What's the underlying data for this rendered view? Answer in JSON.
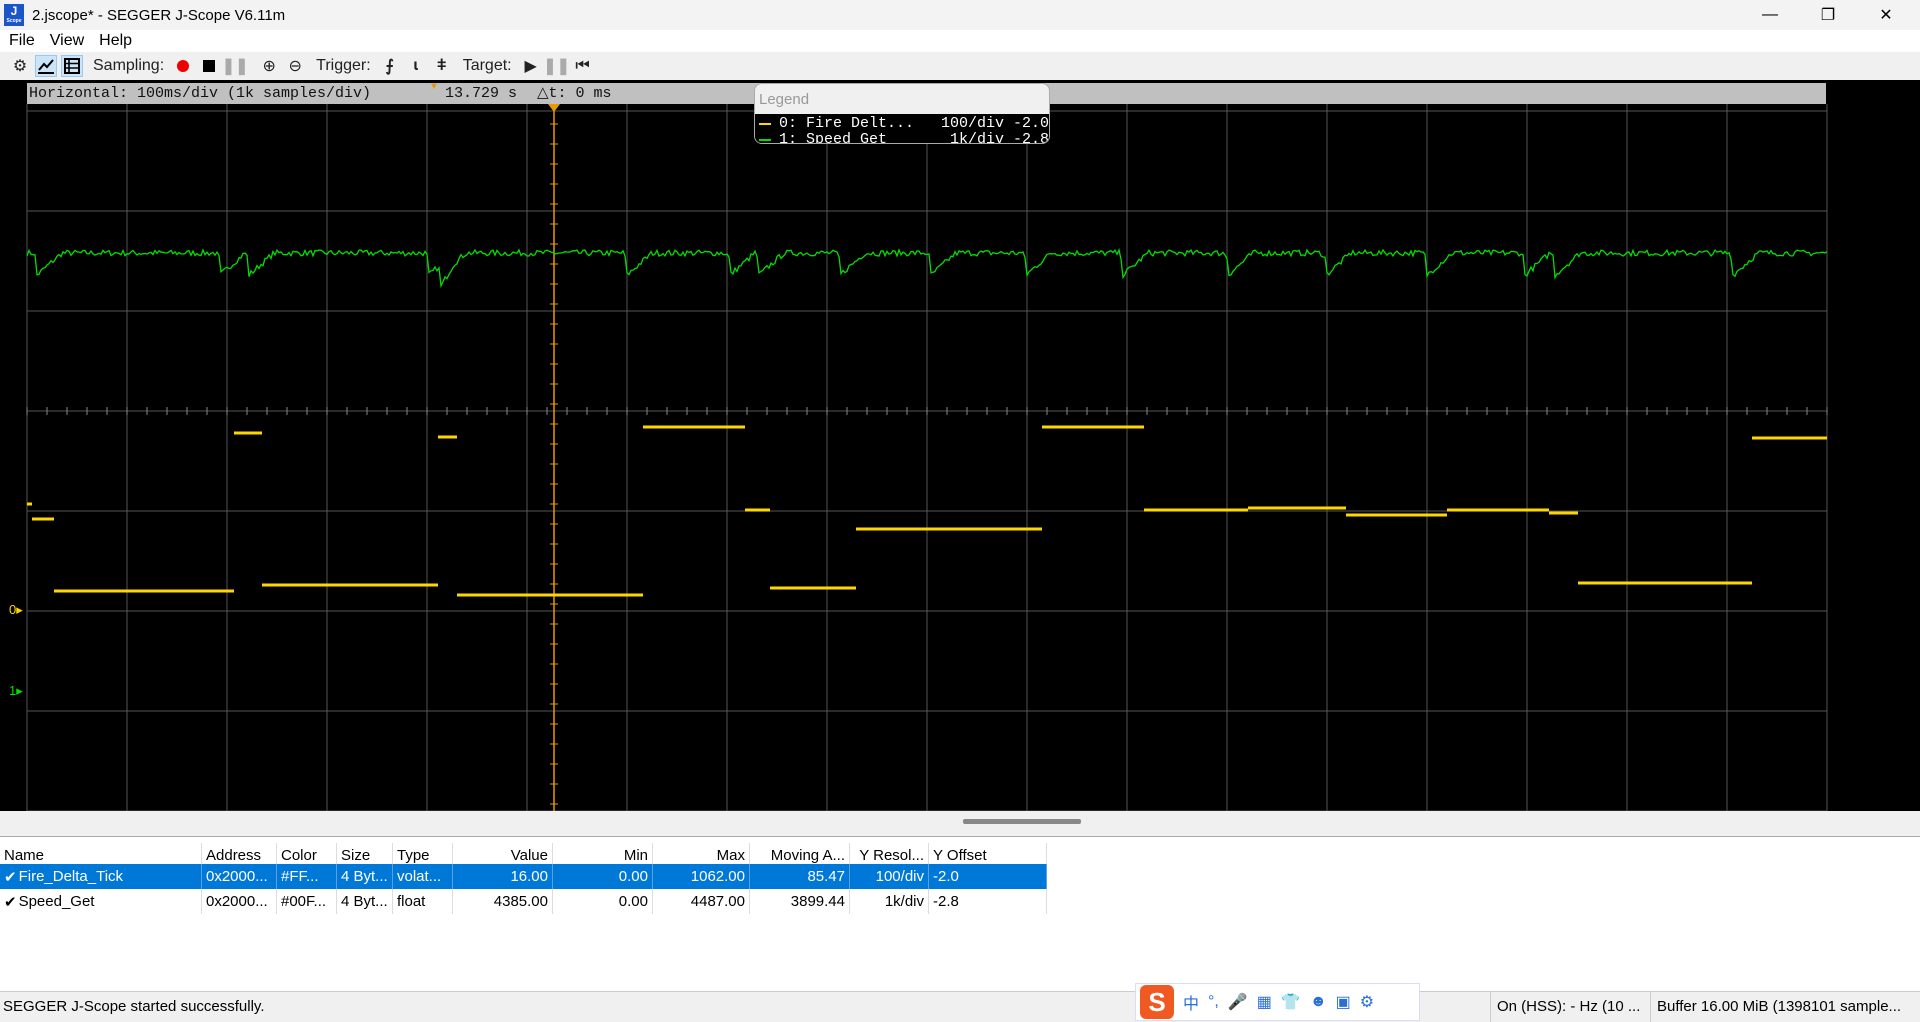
{
  "window": {
    "title": "2.jscope* - SEGGER J-Scope V6.11m",
    "app_icon": "J",
    "app_icon_sub": "Scope",
    "minimize": "—",
    "restore": "❐",
    "close": "✕"
  },
  "menu": [
    "File",
    "View",
    "Help"
  ],
  "toolbar": {
    "sampling_label": "Sampling:",
    "trigger_label": "Trigger:",
    "target_label": "Target:"
  },
  "scope": {
    "horizontal": "Horizontal: 100ms/div (1k samples/div)",
    "cursor_time": "13.729 s",
    "delta_t": "△t: 0 ms",
    "colors": {
      "ch0": "#ffd700",
      "ch1": "#00e000",
      "cursor": "#e89a00",
      "grid": "#555555"
    }
  },
  "legend": {
    "title": "Legend",
    "items": [
      {
        "text": "0: Fire Delt...   100/div -2.0",
        "color": "#ffd700"
      },
      {
        "text": "1: Speed Get       1k/div -2.8",
        "color": "#00e000"
      }
    ]
  },
  "markers": [
    {
      "label": "0",
      "color": "#ffd700"
    },
    {
      "label": "1",
      "color": "#00e000"
    }
  ],
  "chart_data": {
    "type": "line",
    "x_unit": "ms",
    "x_per_div": 100,
    "x_range": [
      0,
      1800
    ],
    "series": [
      {
        "name": "Fire_Delta_Tick",
        "units_per_div": 100,
        "offset_div": -2.0,
        "color": "#ffd700",
        "steps": [
          [
            0,
            5,
            107
          ],
          [
            5,
            27,
            92
          ],
          [
            27,
            207,
            20
          ],
          [
            207,
            235,
            178
          ],
          [
            235,
            411,
            26
          ],
          [
            411,
            430,
            174
          ],
          [
            430,
            616,
            16
          ],
          [
            616,
            718,
            184
          ],
          [
            718,
            743,
            101
          ],
          [
            743,
            829,
            23
          ],
          [
            829,
            1015,
            82
          ],
          [
            1015,
            1117,
            184
          ],
          [
            1117,
            1221,
            101
          ],
          [
            1221,
            1319,
            103
          ],
          [
            1319,
            1420,
            96
          ],
          [
            1420,
            1522,
            101
          ],
          [
            1522,
            1551,
            98
          ],
          [
            1551,
            1725,
            28
          ],
          [
            1725,
            1800,
            173
          ]
        ]
      },
      {
        "name": "Speed_Get",
        "units_per_div": 1000,
        "offset_div": -2.8,
        "color": "#00e000",
        "baseline": 4380,
        "dip_depth": 220,
        "dips_ms": [
          10,
          193,
          222,
          402,
          414,
          600,
          703,
          732,
          813,
          904,
          999,
          1096,
          1201,
          1299,
          1400,
          1498,
          1528,
          1706
        ]
      }
    ]
  },
  "table": {
    "headers": [
      "Name",
      "Address",
      "Color",
      "Size",
      "Type",
      "Value",
      "Min",
      "Max",
      "Moving A...",
      "Y Resol...",
      "Y Offset"
    ],
    "rows": [
      [
        "Fire_Delta_Tick",
        "0x2000...",
        "#FF...",
        "4 Byt...",
        "volat...",
        "16.00",
        "0.00",
        "1062.00",
        "85.47",
        "100/div",
        "-2.0"
      ],
      [
        "Speed_Get",
        "0x2000...",
        "#00F...",
        "4 Byt...",
        "float",
        "4385.00",
        "0.00",
        "4487.00",
        "3899.44",
        "1k/div",
        "-2.8"
      ]
    ]
  },
  "status": {
    "message": "SEGGER J-Scope started successfully.",
    "connection": "On (HSS): - Hz (10 ...",
    "buffer": "Buffer 16.00 MiB (1398101 sample..."
  },
  "ime": {
    "logo": "S",
    "items": [
      "中",
      "°,",
      "🎤",
      "▦",
      "👕",
      "☻",
      "▣",
      "⚙"
    ]
  }
}
